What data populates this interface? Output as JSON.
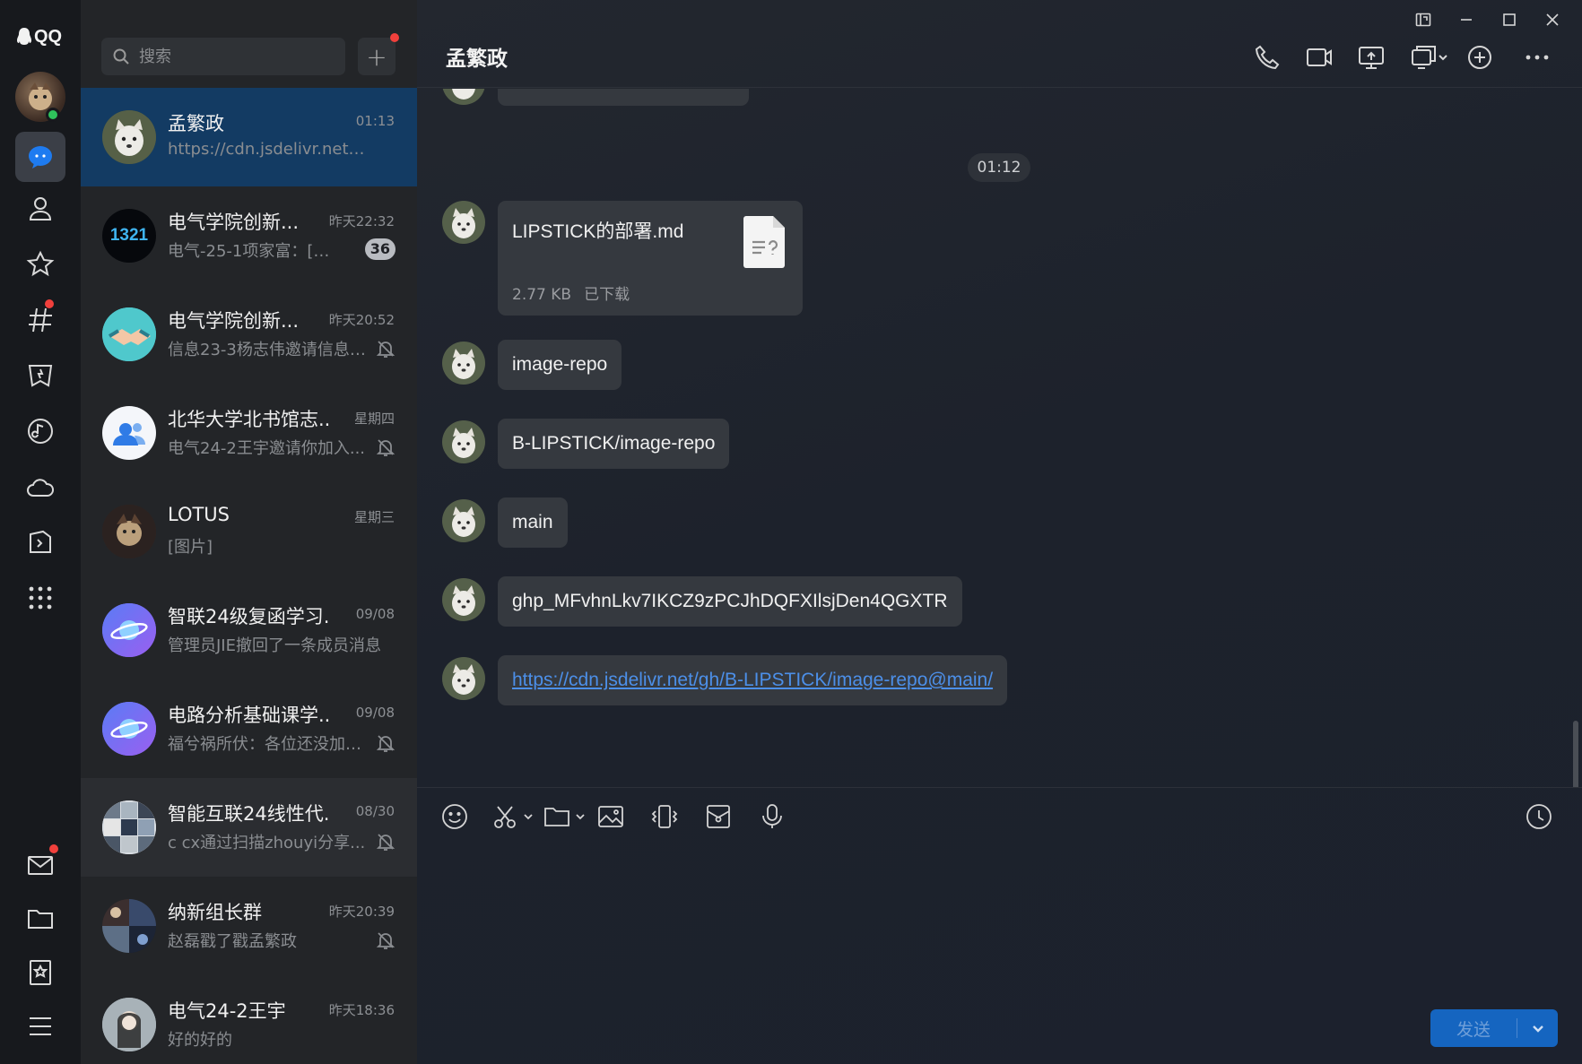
{
  "app": {
    "logo": "QQ"
  },
  "search": {
    "placeholder": "搜索"
  },
  "conversations": [
    {
      "name": "孟繁政",
      "time": "01:13",
      "message": "https://cdn.jsdelivr.net/gh/...",
      "avatar": "dog-avatar",
      "muted": false
    },
    {
      "name": "电气学院创新...",
      "time": "昨天22:32",
      "message": "电气-25-1项家富：[动画...",
      "avatar_text": "1321",
      "unread": "36",
      "muted": false
    },
    {
      "name": "电气学院创新...",
      "time": "昨天20:52",
      "message": "信息23-3杨志伟邀请信息2...",
      "avatar": "handshake-avatar",
      "muted": true
    },
    {
      "name": "北华大学北书馆志...",
      "time": "星期四",
      "message": "电气24-2王宇邀请你加入...",
      "avatar": "group-avatar",
      "muted": true
    },
    {
      "name": "LOTUS",
      "time": "星期三",
      "message": "[图片]",
      "avatar": "photo-avatar",
      "muted": false
    },
    {
      "name": "智联24级复函学习...",
      "time": "09/08",
      "message": "管理员JIE撤回了一条成员消息",
      "avatar": "planet-avatar",
      "muted": false
    },
    {
      "name": "电路分析基础课学...",
      "time": "09/08",
      "message": "福兮祸所伏：各位还没加2...",
      "avatar": "planet-avatar",
      "muted": true
    },
    {
      "name": "智能互联24线性代...",
      "time": "08/30",
      "message": "c cx通过扫描zhouyi分享...",
      "avatar": "collage-avatar",
      "muted": true
    },
    {
      "name": "纳新组长群",
      "time": "昨天20:39",
      "message": "赵磊戳了戳孟繁政",
      "avatar": "collage-avatar",
      "muted": true
    },
    {
      "name": "电气24-2王宇",
      "time": "昨天18:36",
      "message": "好的好的",
      "avatar": "portrait-avatar",
      "muted": false
    }
  ],
  "chat": {
    "title": "孟繁政",
    "time_divider": "01:12",
    "file": {
      "name": "LIPSTICK的部署.md",
      "size": "2.77 KB",
      "status": "已下载"
    },
    "messages": [
      "image-repo",
      "B-LIPSTICK/image-repo",
      "main",
      "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",
      "https://cdn.jsdelivr.net/gh/B-LIPSTICK/image-repo@main/"
    ]
  },
  "send": {
    "label": "发送"
  },
  "colors": {
    "accent": "#1565c0",
    "active_conv": "#133b63",
    "unread_dot": "#f1403c",
    "online": "#2fc25b"
  }
}
